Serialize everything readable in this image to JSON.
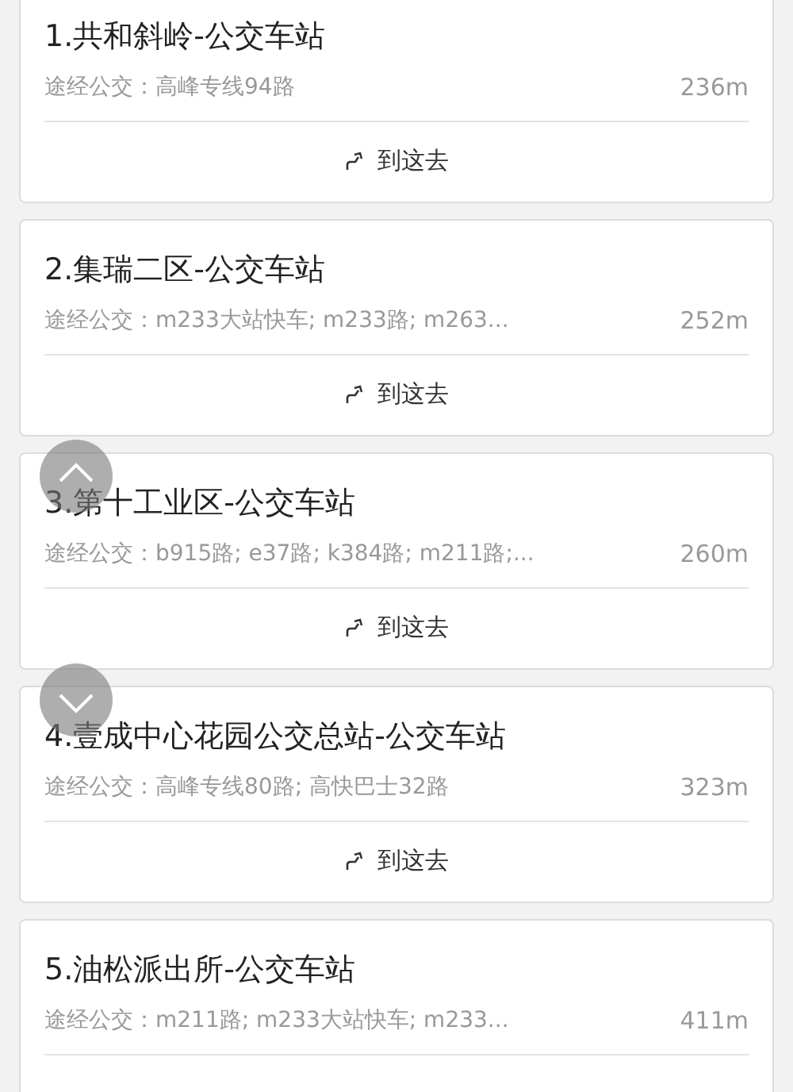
{
  "stations": [
    {
      "title": "1.共和斜岭-公交车站",
      "routes": "途经公交：高峰专线94路",
      "distance": "236m",
      "action": "到这去"
    },
    {
      "title": "2.集瑞二区-公交车站",
      "routes": "途经公交：m233大站快车; m233路; m263...",
      "distance": "252m",
      "action": "到这去"
    },
    {
      "title": "3.第十工业区-公交车站",
      "routes": "途经公交：b915路; e37路; k384路; m211路;...",
      "distance": "260m",
      "action": "到这去"
    },
    {
      "title": "4.壹成中心花园公交总站-公交车站",
      "routes": "途经公交：高峰专线80路; 高快巴士32路",
      "distance": "323m",
      "action": "到这去"
    },
    {
      "title": "5.油松派出所-公交车站",
      "routes": "途经公交：m211路; m233大站快车; m233...",
      "distance": "411m"
    }
  ]
}
